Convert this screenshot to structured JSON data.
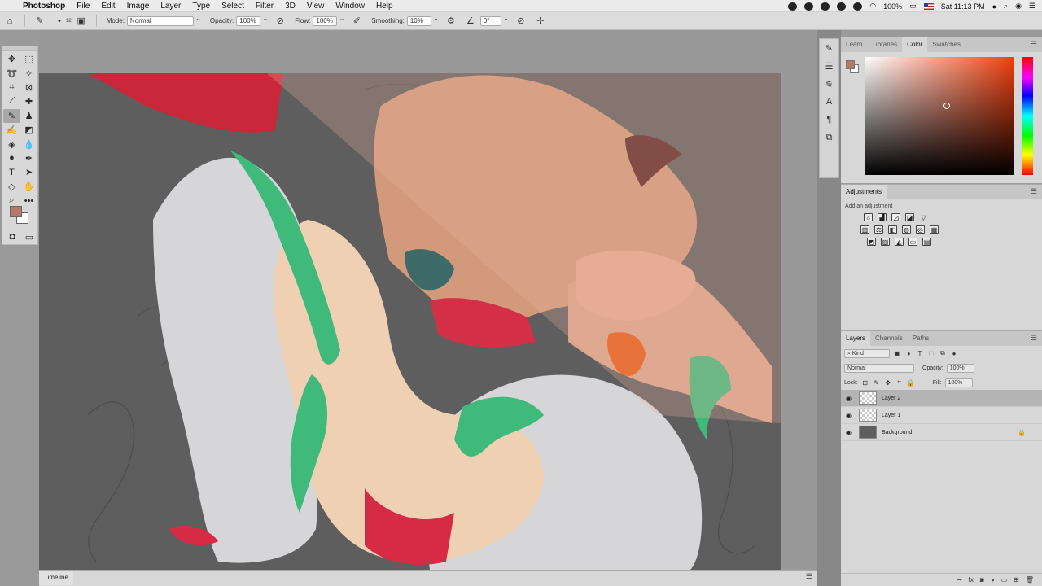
{
  "menubar": {
    "app": "Photoshop",
    "items": [
      "File",
      "Edit",
      "Image",
      "Layer",
      "Type",
      "Select",
      "Filter",
      "3D",
      "View",
      "Window",
      "Help"
    ],
    "battery": "100%",
    "clock": "Sat 11:13 PM"
  },
  "options": {
    "mode_label": "Mode:",
    "mode_value": "Normal",
    "opacity_label": "Opacity:",
    "opacity_value": "100%",
    "flow_label": "Flow:",
    "flow_value": "100%",
    "smoothing_label": "Smoothing:",
    "smoothing_value": "10%",
    "angle_value": "0°",
    "brush_size": "12"
  },
  "right_panels": {
    "color_tabs": [
      "Learn",
      "Libraries",
      "Color",
      "Swatches"
    ],
    "adjustments_title": "Adjustments",
    "adjustments_sub": "Add an adjustment",
    "layers_tabs": [
      "Layers",
      "Channels",
      "Paths"
    ],
    "kind_label": "Kind",
    "blend_mode": "Normal",
    "opacity_label": "Opacity:",
    "opacity_value": "100%",
    "lock_label": "Lock:",
    "fill_label": "Fill:",
    "fill_value": "100%",
    "layers": [
      {
        "name": "Layer 2",
        "selected": true
      },
      {
        "name": "Layer 1",
        "selected": false
      },
      {
        "name": "Background",
        "selected": false
      }
    ]
  },
  "timeline": {
    "label": "Timeline"
  },
  "colors": {
    "foreground": "#b87868",
    "background": "#ffffff",
    "canvas_bg": "#5e5e5e"
  }
}
